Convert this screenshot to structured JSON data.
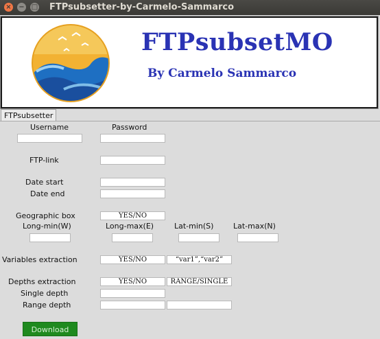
{
  "window": {
    "title": "FTPsubsetter-by-Carmelo-Sammarco"
  },
  "banner": {
    "app_name": "FTPsubsetMO",
    "author": "By Carmelo Sammarco"
  },
  "tab": {
    "label": "FTPsubsetter"
  },
  "form": {
    "username_label": "Username",
    "password_label": "Password",
    "ftp_link_label": "FTP-link",
    "date_start_label": "Date start",
    "date_end_label": "Date end",
    "geo_box_label": "Geographic box",
    "geo_box_value": "YES/NO",
    "long_min_label": "Long-min(W)",
    "long_max_label": "Long-max(E)",
    "lat_min_label": "Lat-min(S)",
    "lat_max_label": "Lat-max(N)",
    "variables_label": "Variables extraction",
    "variables_value": "YES/NO",
    "variables_list_value": "“var1”,“var2”",
    "depths_label": "Depths extraction",
    "depths_value": "YES/NO",
    "depths_mode_value": "RANGE/SINGLE",
    "single_depth_label": "Single depth",
    "range_depth_label": "Range depth"
  },
  "actions": {
    "download_label": "Download"
  },
  "colors": {
    "brand": "#2a33b4",
    "download_bg": "#1f8a1f",
    "close_button": "#f07746"
  }
}
